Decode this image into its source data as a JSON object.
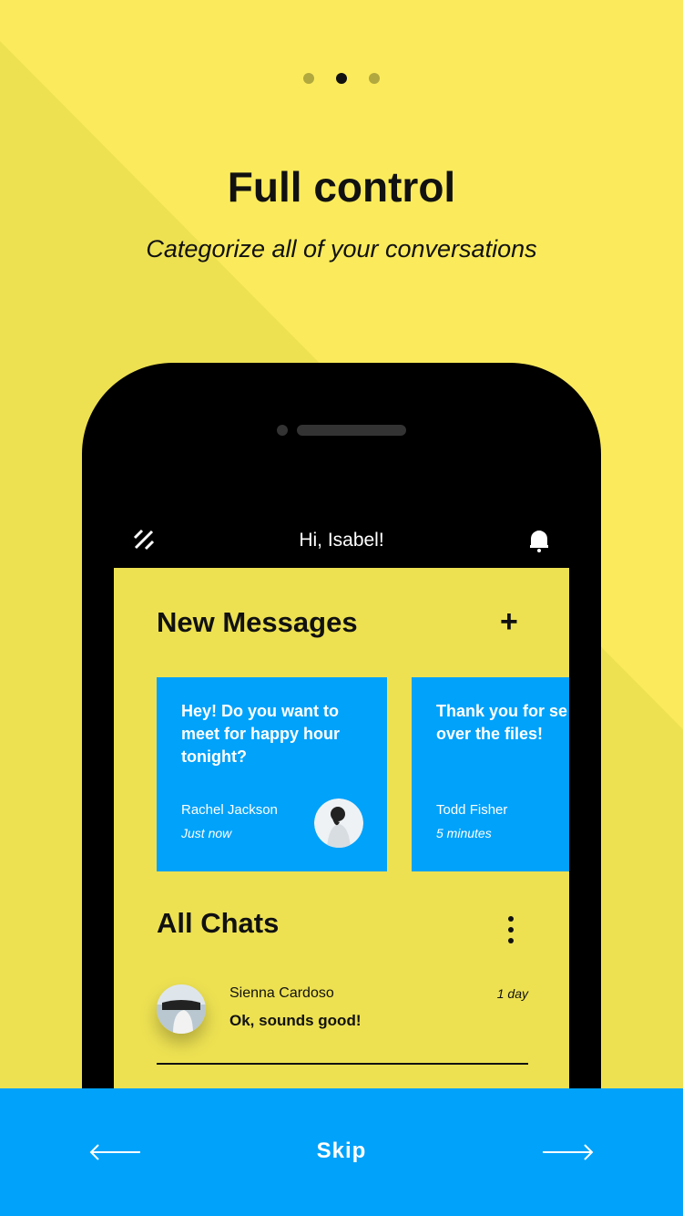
{
  "onboarding": {
    "pager": {
      "total": 3,
      "active": 2
    },
    "title": "Full control",
    "subtitle": "Categorize all of your conversations",
    "skip_label": "Skip",
    "back_icon": "arrow-left-icon",
    "next_icon": "arrow-right-icon"
  },
  "phone": {
    "header": {
      "greeting": "Hi, Isabel!",
      "menu_icon": "app-logo-icon",
      "bell_icon": "bell-icon"
    },
    "new_messages": {
      "title": "New Messages",
      "add_icon": "plus-icon",
      "cards": [
        {
          "message": "Hey! Do you want to\nmeet for happy hour\ntonight?",
          "name": "Rachel Jackson",
          "time": "Just now"
        },
        {
          "message": "Thank you for se\nover the files!",
          "name": "Todd Fisher",
          "time": "5 minutes"
        }
      ]
    },
    "all_chats": {
      "title": "All Chats",
      "more_icon": "kebab-menu-icon",
      "items": [
        {
          "name": "Sienna Cardoso",
          "message": "Ok, sounds good!",
          "time": "1 day"
        }
      ]
    }
  },
  "colors": {
    "background": "#fbeb5c",
    "accent_blue": "#00a2fa",
    "text": "#111111"
  }
}
